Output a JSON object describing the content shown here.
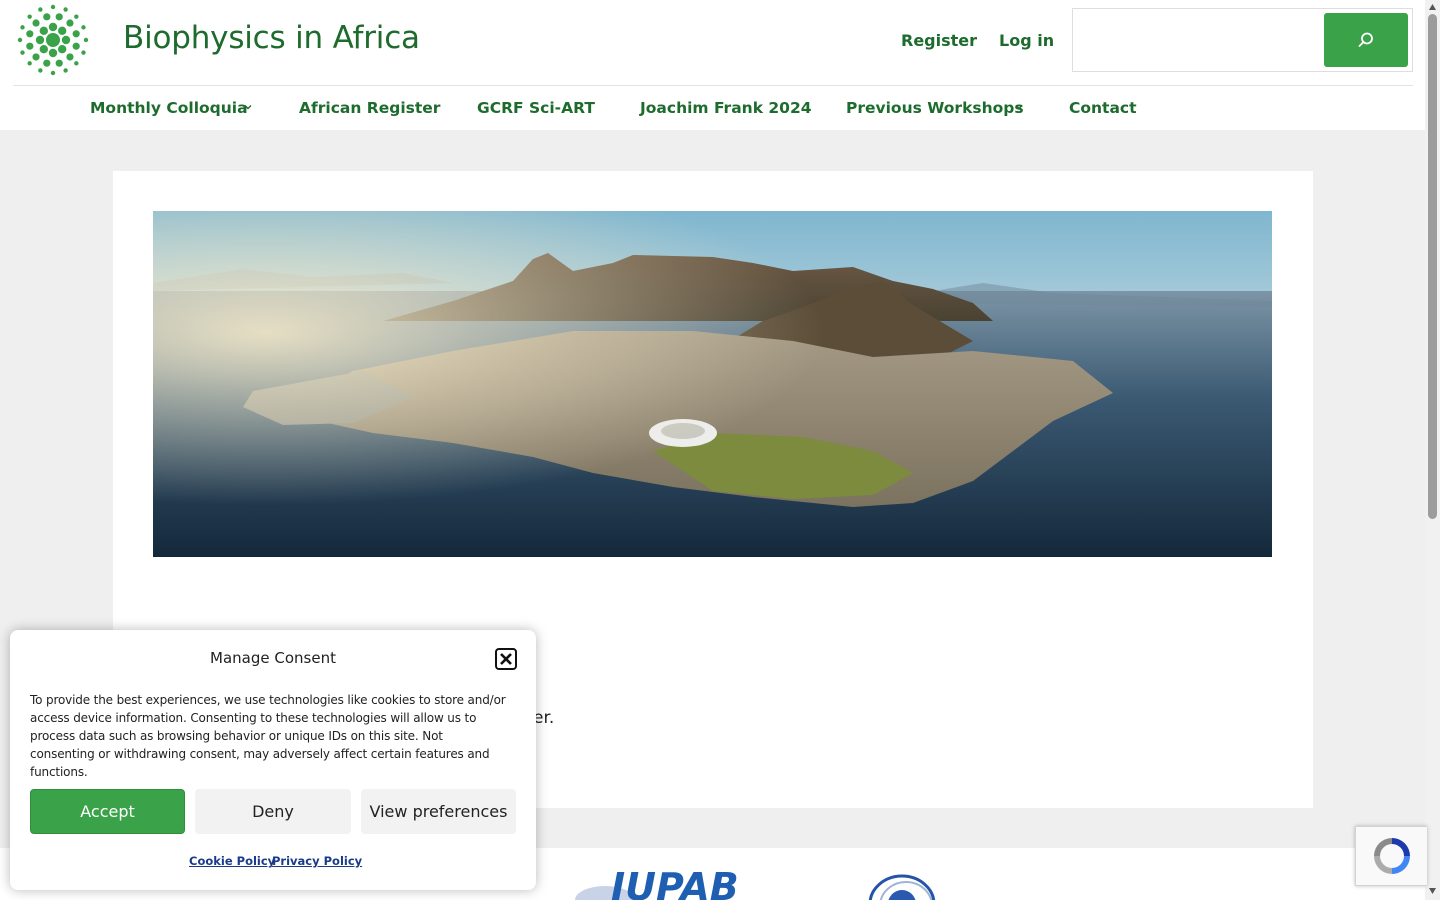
{
  "site": {
    "title": "Biophysics in Africa",
    "accent_color": "#1e6b2e",
    "button_color": "#3aa34a"
  },
  "header": {
    "links": [
      {
        "label": "Register"
      },
      {
        "label": "Log in"
      }
    ],
    "search": {
      "placeholder": "",
      "button_icon": "search-icon"
    }
  },
  "nav": {
    "items": [
      {
        "label": "Monthly Colloquia",
        "has_submenu": true
      },
      {
        "label": "African Register",
        "has_submenu": false
      },
      {
        "label": "GCRF Sci-ART",
        "has_submenu": false
      },
      {
        "label": "Joachim Frank 2024",
        "has_submenu": false
      },
      {
        "label": "Previous Workshops",
        "has_submenu": true
      },
      {
        "label": "Contact",
        "has_submenu": false
      }
    ]
  },
  "main": {
    "partial_text": "er."
  },
  "footer": {
    "logo_text": "IUPAB"
  },
  "consent": {
    "title": "Manage Consent",
    "body": "To provide the best experiences, we use technologies like cookies to store and/or access device information. Consenting to these technologies will allow us to process data such as browsing behavior or unique IDs on this site. Not consenting or withdrawing consent, may adversely affect certain features and functions.",
    "accept_label": "Accept",
    "deny_label": "Deny",
    "preferences_label": "View preferences",
    "cookie_policy_label": "Cookie Policy",
    "privacy_policy_label": "Privacy Policy"
  }
}
